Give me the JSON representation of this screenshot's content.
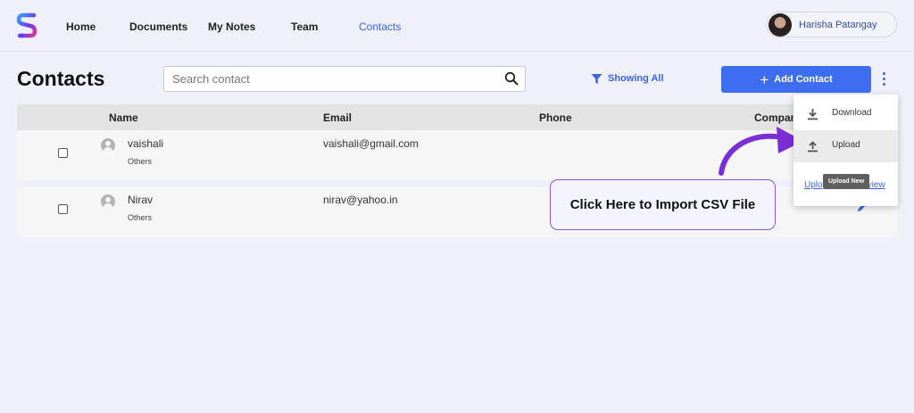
{
  "nav": {
    "links": [
      {
        "label": "Home"
      },
      {
        "label": "Documents"
      },
      {
        "label": "My Notes"
      },
      {
        "label": "Team"
      },
      {
        "label": "Contacts"
      }
    ],
    "active": "Contacts",
    "user_name": "Harisha Patangay"
  },
  "header": {
    "title": "Contacts",
    "search_placeholder": "Search contact",
    "filter_label": "Showing All",
    "add_button_label": "Add Contact"
  },
  "table": {
    "columns": [
      "Name",
      "Email",
      "Phone",
      "Compan"
    ],
    "rows": [
      {
        "name": "vaishali",
        "group": "Others",
        "email": "vaishali@gmail.com",
        "phone": ""
      },
      {
        "name": "Nirav",
        "group": "Others",
        "email": "nirav@yahoo.in",
        "phone": ""
      }
    ]
  },
  "menu": {
    "items": [
      {
        "label": "Download",
        "icon": "download-icon"
      },
      {
        "label": "Upload",
        "icon": "upload-icon"
      }
    ],
    "link_left": "Uplo",
    "link_right": "view",
    "tooltip": "Upload New"
  },
  "callout": {
    "text": "Click Here to Import CSV File"
  },
  "colors": {
    "accent": "#3e63e6",
    "button": "#3d6ef2",
    "callout_border": "#8a55d8",
    "arrow": "#7a2fd6"
  }
}
